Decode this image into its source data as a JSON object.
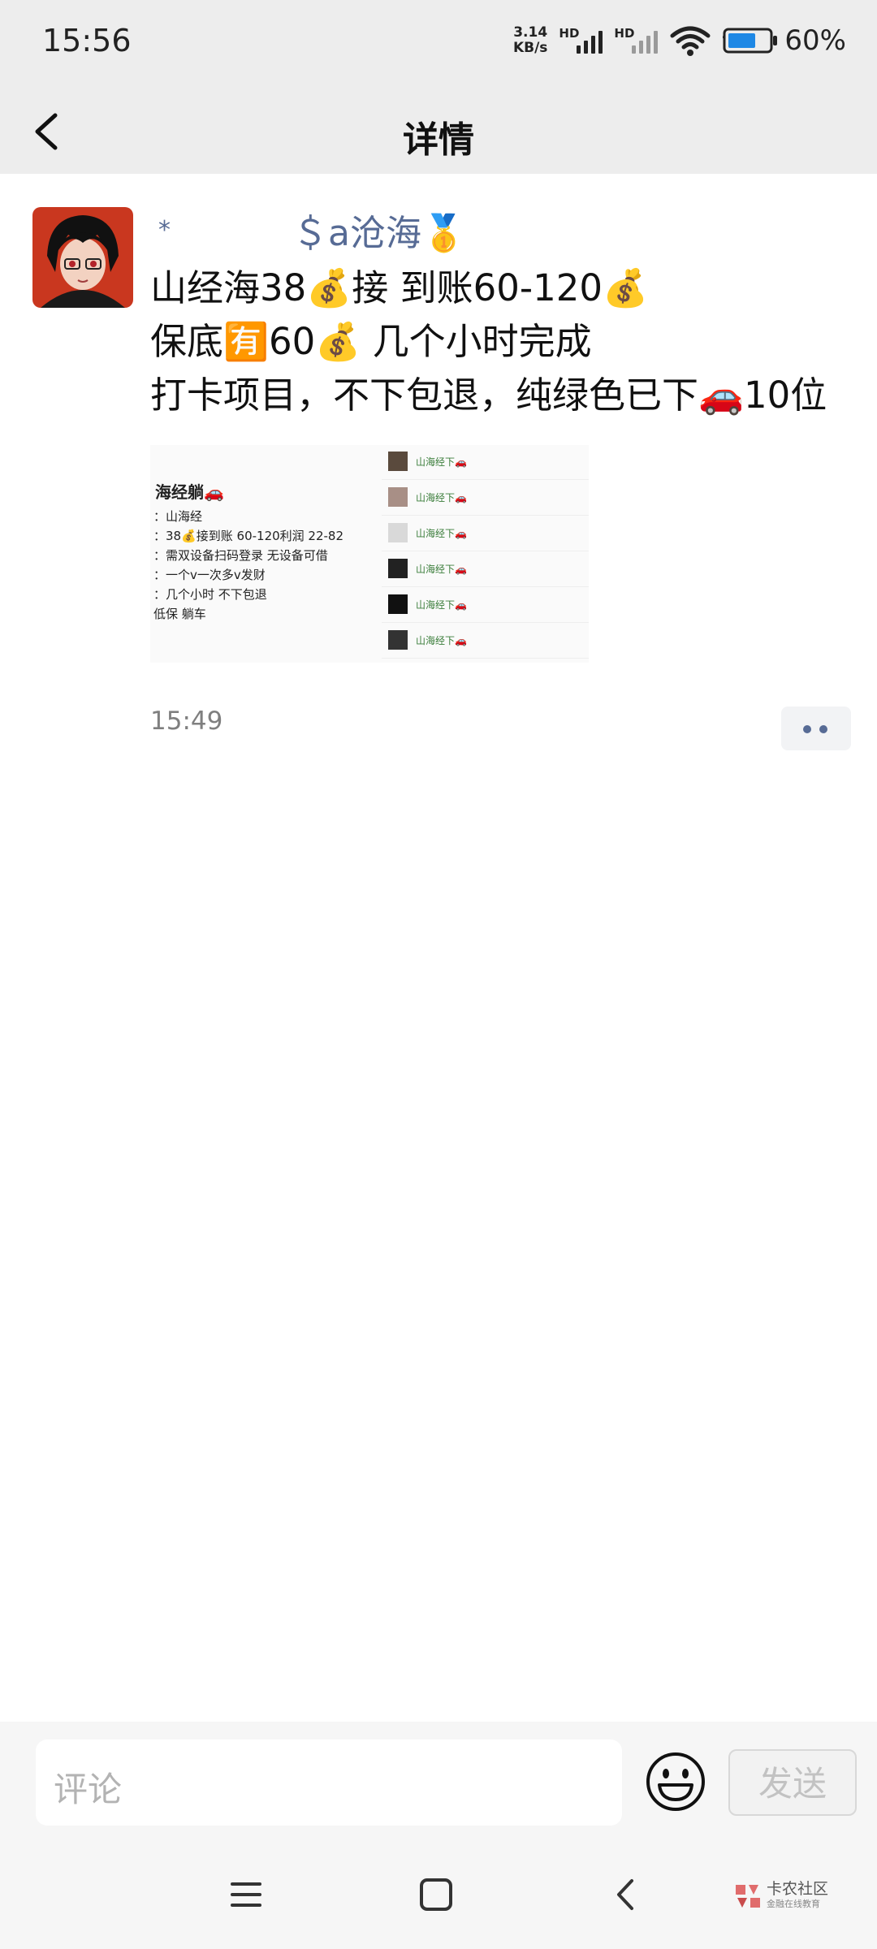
{
  "status_bar": {
    "time": "15:56",
    "net_speed_value": "3.14",
    "net_speed_unit": "KB/s",
    "hd_label_1": "HD",
    "hd_label_2": "HD",
    "battery_percent": "60%",
    "battery_level": 0.6
  },
  "header": {
    "title": "详情",
    "back_icon": "chevron-left-icon"
  },
  "post": {
    "author_prefix": "*",
    "author_name": "＄a沧海🥇",
    "lines": [
      "山经海38💰接 到账60-120💰",
      "保底🈶60💰 几个小时完成",
      "打卡项目，不下包退，纯绿色已下🚗10位"
    ],
    "image": {
      "title": "海经躺🚗",
      "rows": [
        "：山海经",
        "：38💰接到账 60-120利润 22-82",
        "：需双设备扫码登录 无设备可借",
        "：一个v一次多v发财",
        "：几个小时 不下包退",
        "低保 躺车"
      ],
      "chat_items": [
        "山海经下🚗",
        "山海经下🚗",
        "山海经下🚗",
        "山海经下🚗",
        "山海经下🚗",
        "山海经下🚗"
      ]
    },
    "time": "15:49"
  },
  "comment_bar": {
    "placeholder": "评论",
    "send_label": "发送",
    "emoji_icon": "smiley-icon"
  },
  "nav_bar": {
    "menu_icon": "menu-icon",
    "home_icon": "square-home-icon",
    "back_icon": "back-triangle-icon"
  },
  "watermark": {
    "text": "卡农社区",
    "sub": "金融在线教育"
  }
}
